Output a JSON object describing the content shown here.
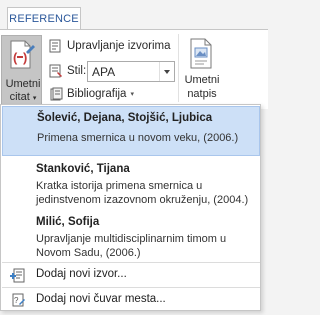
{
  "ribbon": {
    "tab_label": "REFERENCE",
    "insert_citation": {
      "line1": "Umetni",
      "line2": "citat"
    },
    "manage_sources": "Upravljanje izvorima",
    "style_label": "Stil:",
    "style_value": "APA",
    "bibliography": "Bibliografija",
    "insert_caption": {
      "line1": "Umetni",
      "line2": "natpis"
    }
  },
  "dropdown": {
    "citations": [
      {
        "authors": "Šolević, Dejana, Stojšić, Ljubica",
        "details": "Primena smernica u novom veku, (2006.)"
      },
      {
        "authors": "Stanković, Tijana",
        "details": "Kratka istorija primena smernica u jedinstvenom izazovnom okruženju, (2004.)"
      },
      {
        "authors": "Milić, Sofija",
        "details": "Upravljanje multidisciplinarnim timom u Novom Sadu, (2006.)"
      }
    ],
    "add_source": "Dodaj novi izvor...",
    "add_placeholder": "Dodaj novi čuvar mesta..."
  },
  "colors": {
    "accent": "#2b579a",
    "highlight": "#cde0f7",
    "pressed": "#c5c5c5"
  }
}
